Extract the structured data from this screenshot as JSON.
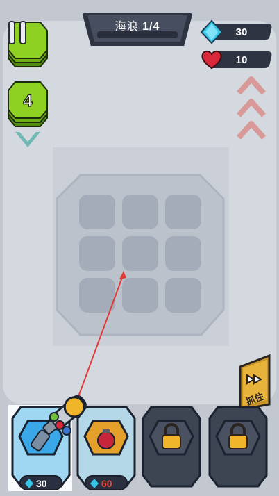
{
  "hud": {
    "wave_label": "海浪",
    "wave_value": "1/4",
    "gems": "30",
    "lives": "10",
    "stack_count": "4"
  },
  "controls": {
    "fast_forward_label": "抓住"
  },
  "cards": [
    {
      "name": "cannon-tower",
      "cost": "30",
      "state": "selected"
    },
    {
      "name": "bomb-tower",
      "cost": "60",
      "state": "unaffordable"
    },
    {
      "name": "locked-slot-1",
      "cost": "",
      "state": "locked"
    },
    {
      "name": "locked-slot-2",
      "cost": "",
      "state": "locked"
    }
  ],
  "colors": {
    "gem": "#38c6e8",
    "heart": "#d8283a",
    "enemy_green": "#8ed122",
    "gold": "#f0b52a",
    "cost_red": "#e8443c",
    "cost_white": "#ffffff"
  }
}
